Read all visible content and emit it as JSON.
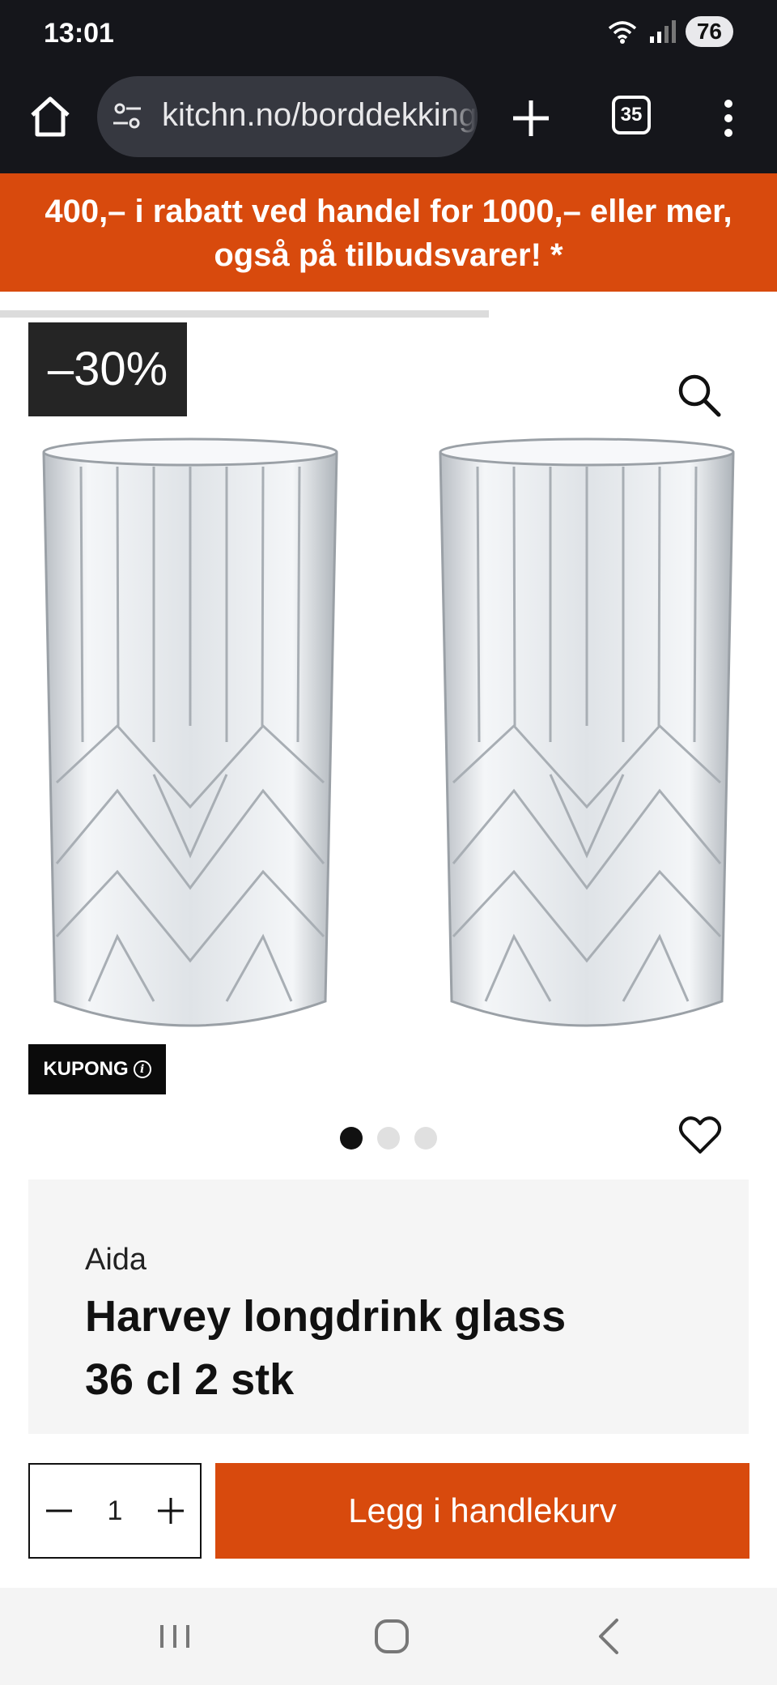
{
  "status_bar": {
    "time": "13:01",
    "battery": "76",
    "icons": [
      "wifi-icon",
      "signal-icon"
    ]
  },
  "browser": {
    "url": "kitchn.no/borddekking",
    "tab_count": "35",
    "icons": [
      "home-icon",
      "site-settings-icon",
      "new-tab-icon",
      "more-menu-icon"
    ]
  },
  "promo": {
    "line1": "400,– i rabatt ved handel for 1000,– eller mer,",
    "line2": "også på tilbudsvarer! *"
  },
  "gallery": {
    "discount": "–30%",
    "coupon_label": "KUPONG",
    "image_count": 3,
    "active_image": 1
  },
  "product": {
    "brand": "Aida",
    "title_line1": "Harvey longdrink glass",
    "title_line2": "36 cl 2 stk"
  },
  "purchase": {
    "quantity": "1",
    "add_to_cart": "Legg i handlekurv"
  },
  "colors": {
    "accent": "#d84a0d",
    "dark": "#15161b",
    "badge": "#252525"
  }
}
